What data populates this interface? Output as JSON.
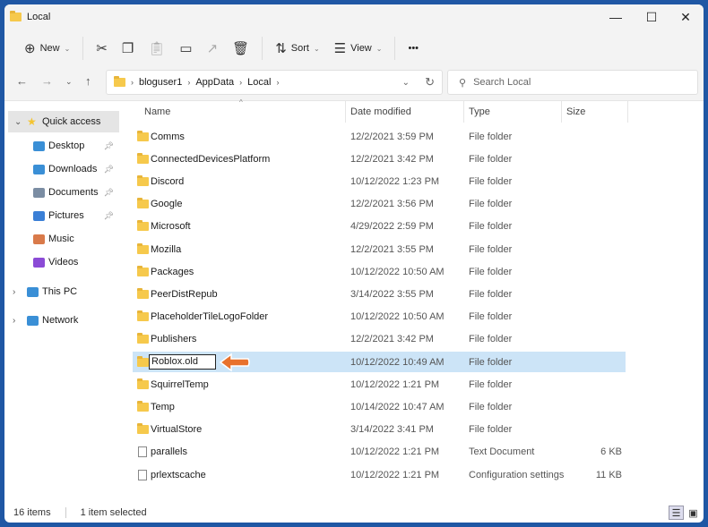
{
  "window": {
    "title": "Local",
    "minimize": "—",
    "maximize": "☐",
    "close": "✕"
  },
  "toolbar": {
    "new_label": "New",
    "sort_label": "Sort",
    "view_label": "View",
    "more": "•••"
  },
  "nav": {
    "breadcrumb": [
      "bloguser1",
      "AppData",
      "Local"
    ],
    "search_placeholder": "Search Local"
  },
  "sidebar": {
    "items": [
      {
        "label": "Quick access",
        "color": "#f4c430"
      },
      {
        "label": "Desktop",
        "color": "#3a8fd6"
      },
      {
        "label": "Downloads",
        "color": "#3a8fd6"
      },
      {
        "label": "Documents",
        "color": "#7b8da3"
      },
      {
        "label": "Pictures",
        "color": "#3a7fd6"
      },
      {
        "label": "Music",
        "color": "#d97a4a"
      },
      {
        "label": "Videos",
        "color": "#8b4bd6"
      },
      {
        "label": "This PC",
        "color": "#3a8fd6"
      },
      {
        "label": "Network",
        "color": "#3a8fd6"
      }
    ]
  },
  "columns": {
    "name": "Name",
    "date": "Date modified",
    "type": "Type",
    "size": "Size"
  },
  "files": [
    {
      "name": "Comms",
      "date": "12/2/2021 3:59 PM",
      "type": "File folder",
      "size": ""
    },
    {
      "name": "ConnectedDevicesPlatform",
      "date": "12/2/2021 3:42 PM",
      "type": "File folder",
      "size": ""
    },
    {
      "name": "Discord",
      "date": "10/12/2022 1:23 PM",
      "type": "File folder",
      "size": ""
    },
    {
      "name": "Google",
      "date": "12/2/2021 3:56 PM",
      "type": "File folder",
      "size": ""
    },
    {
      "name": "Microsoft",
      "date": "4/29/2022 2:59 PM",
      "type": "File folder",
      "size": ""
    },
    {
      "name": "Mozilla",
      "date": "12/2/2021 3:55 PM",
      "type": "File folder",
      "size": ""
    },
    {
      "name": "Packages",
      "date": "10/12/2022 10:50 AM",
      "type": "File folder",
      "size": ""
    },
    {
      "name": "PeerDistRepub",
      "date": "3/14/2022 3:55 PM",
      "type": "File folder",
      "size": ""
    },
    {
      "name": "PlaceholderTileLogoFolder",
      "date": "10/12/2022 10:50 AM",
      "type": "File folder",
      "size": ""
    },
    {
      "name": "Publishers",
      "date": "12/2/2021 3:42 PM",
      "type": "File folder",
      "size": ""
    },
    {
      "name": "Roblox.old",
      "date": "10/12/2022 10:49 AM",
      "type": "File folder",
      "size": ""
    },
    {
      "name": "SquirrelTemp",
      "date": "10/12/2022 1:21 PM",
      "type": "File folder",
      "size": ""
    },
    {
      "name": "Temp",
      "date": "10/14/2022 10:47 AM",
      "type": "File folder",
      "size": ""
    },
    {
      "name": "VirtualStore",
      "date": "3/14/2022 3:41 PM",
      "type": "File folder",
      "size": ""
    },
    {
      "name": "parallels",
      "date": "10/12/2022 1:21 PM",
      "type": "Text Document",
      "size": "6 KB"
    },
    {
      "name": "prlextscache",
      "date": "10/12/2022 1:21 PM",
      "type": "Configuration settings",
      "size": "11 KB"
    }
  ],
  "status": {
    "count": "16 items",
    "selected": "1 item selected"
  },
  "accent": "#cce4f7",
  "arrow_color": "#e8712c"
}
